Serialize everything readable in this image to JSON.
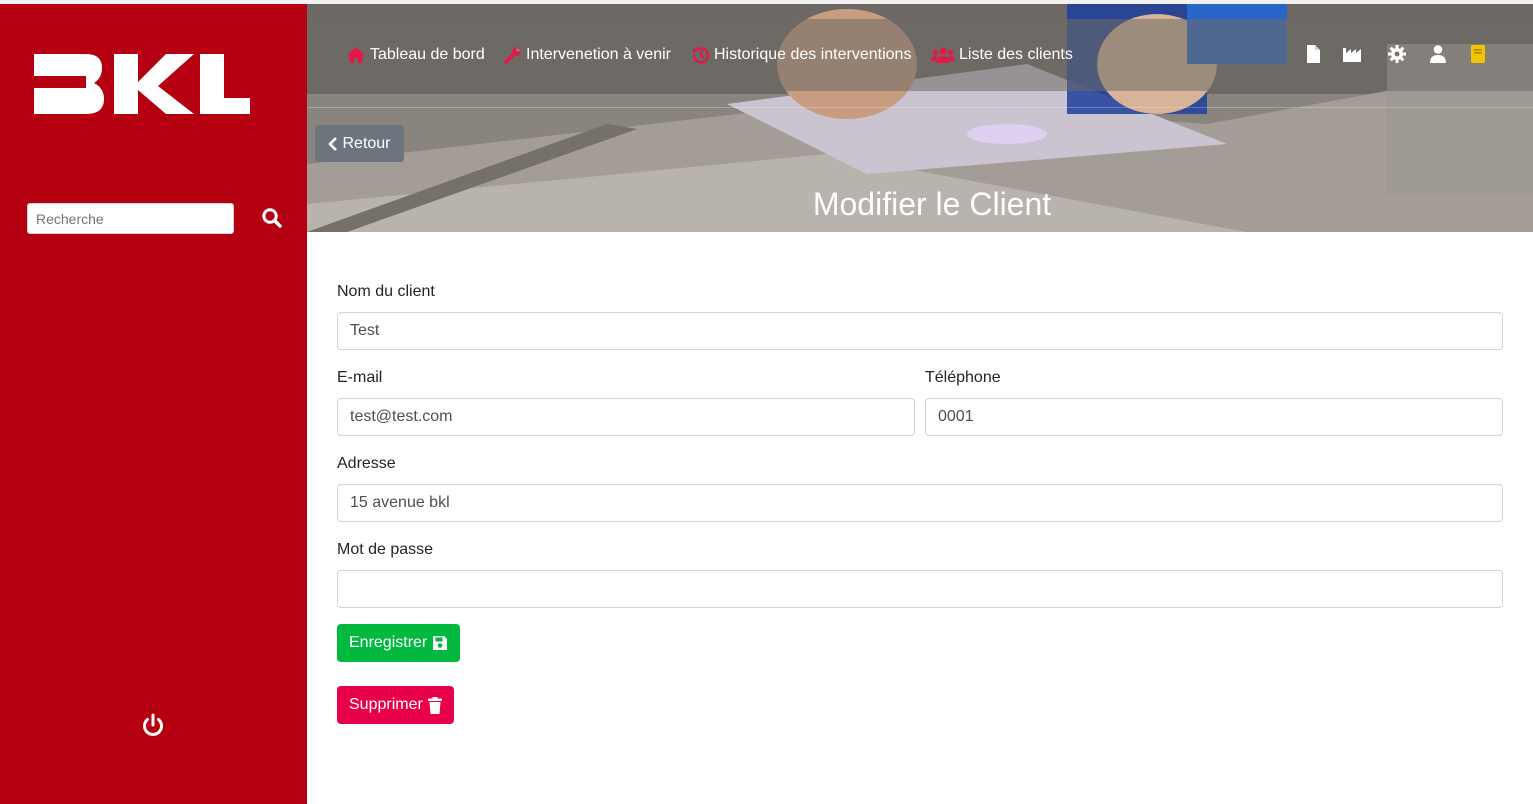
{
  "brand": {
    "logo_text": "BKL"
  },
  "sidebar": {
    "search_placeholder": "Recherche"
  },
  "nav": {
    "items": [
      {
        "label": "Tableau de bord",
        "icon": "home-icon"
      },
      {
        "label": "Intervenetion à venir",
        "icon": "wrench-icon"
      },
      {
        "label": "Historique des interventions",
        "icon": "history-icon"
      },
      {
        "label": "Liste des clients",
        "icon": "users-icon"
      }
    ],
    "right_icons": [
      "file-icon",
      "factory-icon",
      "gear-icon",
      "user-icon",
      "book-icon"
    ]
  },
  "header": {
    "back_label": "Retour",
    "title": "Modifier le Client"
  },
  "form": {
    "name_label": "Nom du client",
    "name_value": "Test",
    "email_label": "E-mail",
    "email_value": "test@test.com",
    "phone_label": "Téléphone",
    "phone_value": "0001",
    "address_label": "Adresse",
    "address_value": "15 avenue bkl",
    "password_label": "Mot de passe",
    "password_value": "",
    "save_label": "Enregistrer",
    "delete_label": "Supprimer"
  },
  "colors": {
    "sidebar": "#b50012",
    "nav_icon": "#e8154a",
    "save": "#00b93e",
    "delete": "#e8004a",
    "back": "#6c757d"
  }
}
